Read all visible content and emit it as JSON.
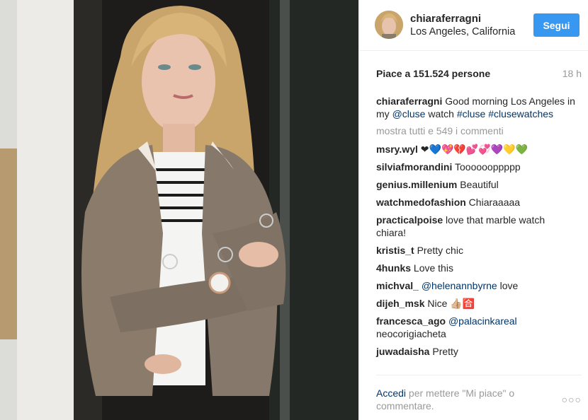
{
  "post": {
    "username": "chiaraferragni",
    "location": "Los Angeles, California",
    "follow_label": "Segui",
    "likes_text": "Piace a 151.524 persone",
    "time_ago": "18 h",
    "caption": {
      "user": "chiaraferragni",
      "text1": " Good morning Los Angeles in my ",
      "mention": "@cluse",
      "text2": " watch ",
      "tag1": "#cluse",
      "space": " ",
      "tag2": "#clusewatches"
    },
    "show_all_label": "mostra tutti e 549 i commenti",
    "comments": [
      {
        "user": "msry.wyl",
        "text": " ❤💙💖💔💕💞💜💛💚"
      },
      {
        "user": "silviafmorandini",
        "text": " Tooooooppppp"
      },
      {
        "user": "genius.millenium",
        "text": " Beautiful"
      },
      {
        "user": "watchmedofashion",
        "text": " Chiaraaaaa"
      },
      {
        "user": "practicalpoise",
        "text": " love that marble watch chiara!"
      },
      {
        "user": "kristis_t",
        "text": " Pretty chic"
      },
      {
        "user": "4hunks",
        "text": " Love this"
      },
      {
        "user": "michval_",
        "mention": " @helenannbyrne",
        "text": " love"
      },
      {
        "user": "dijeh_msk",
        "text": " Nice 👍🏼🈴"
      },
      {
        "user": "francesca_ago",
        "mention": " @palacinkareal",
        "text": " neocorigiacheta"
      },
      {
        "user": "juwadaisha",
        "text": " Pretty"
      }
    ],
    "footer": {
      "like_link": "Accedi",
      "rest": " per mettere \"Mi piace\" o commentare."
    },
    "more_label": "○○○"
  },
  "icons": {
    "more": "more-options-icon",
    "avatar": "profile-avatar"
  },
  "colors": {
    "accent": "#3897f0",
    "link": "#003569",
    "muted": "#999999",
    "text": "#262626"
  }
}
